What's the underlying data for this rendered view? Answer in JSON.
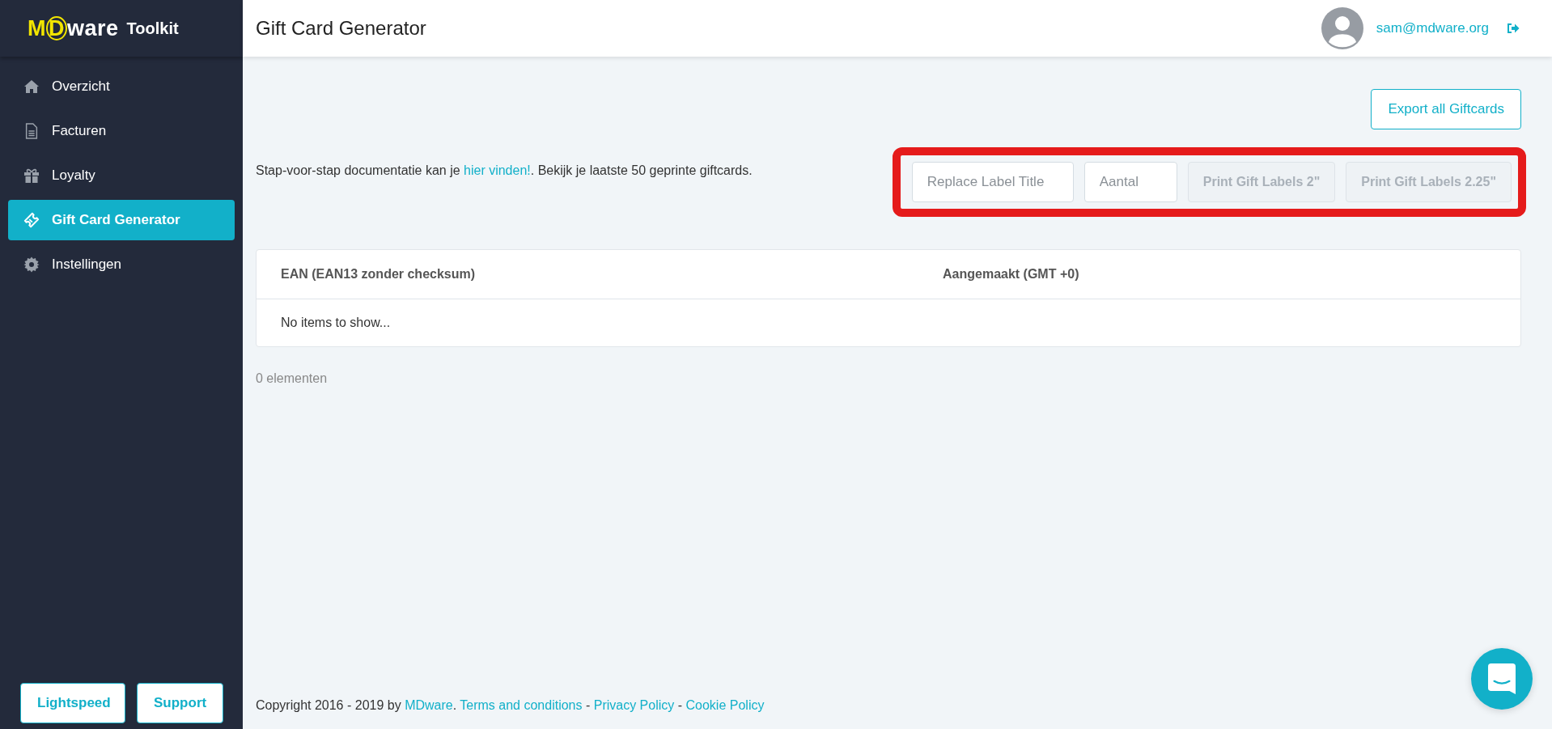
{
  "sidebar": {
    "logo": {
      "letter_1": "M",
      "letter_2": "D",
      "rest": "ware",
      "product": "Toolkit"
    },
    "nav": [
      {
        "label": "Overzicht",
        "selected": false
      },
      {
        "label": "Facturen",
        "selected": false
      },
      {
        "label": "Loyalty",
        "selected": false
      },
      {
        "label": "Gift Card Generator",
        "selected": true
      },
      {
        "label": "Instellingen",
        "selected": false
      }
    ],
    "buttons": [
      "Lightspeed",
      "Support"
    ]
  },
  "header": {
    "title": "Gift Card Generator",
    "user_email": "sam@mdware.org"
  },
  "export_button": "Export all Giftcards",
  "intro": [
    {
      "kind": "text",
      "text": "Stap-voor-stap documentatie kan je "
    },
    {
      "kind": "link",
      "text": "hier vinden!"
    },
    {
      "kind": "text",
      "text": ". Bekijk je laatste 50 geprinte giftcards."
    }
  ],
  "toolbar": {
    "highlighted": true,
    "title_field": {
      "placeholder": "Replace Label Title"
    },
    "quantity_field": {
      "placeholder": "Aantal"
    },
    "buttons": [
      {
        "label": "Print Gift Labels 2\"",
        "disabled": true
      },
      {
        "label": "Print Gift Labels 2.25\"",
        "disabled": true
      }
    ]
  },
  "table": {
    "columns": [
      "EAN (EAN13 zonder checksum)",
      "Aangemaakt (GMT +0)"
    ],
    "empty_message": "No items to show..."
  },
  "count": "0 elementen",
  "footer": [
    {
      "kind": "text",
      "text": "Copyright 2016 - 2019 by "
    },
    {
      "kind": "link",
      "text": "MDware"
    },
    {
      "kind": "text",
      "text": ". "
    },
    {
      "kind": "link",
      "text": "Terms and conditions"
    },
    {
      "kind": "text",
      "text": " - "
    },
    {
      "kind": "link",
      "text": "Privacy Policy"
    },
    {
      "kind": "text",
      "text": " - "
    },
    {
      "kind": "link",
      "text": "Cookie Policy"
    }
  ]
}
